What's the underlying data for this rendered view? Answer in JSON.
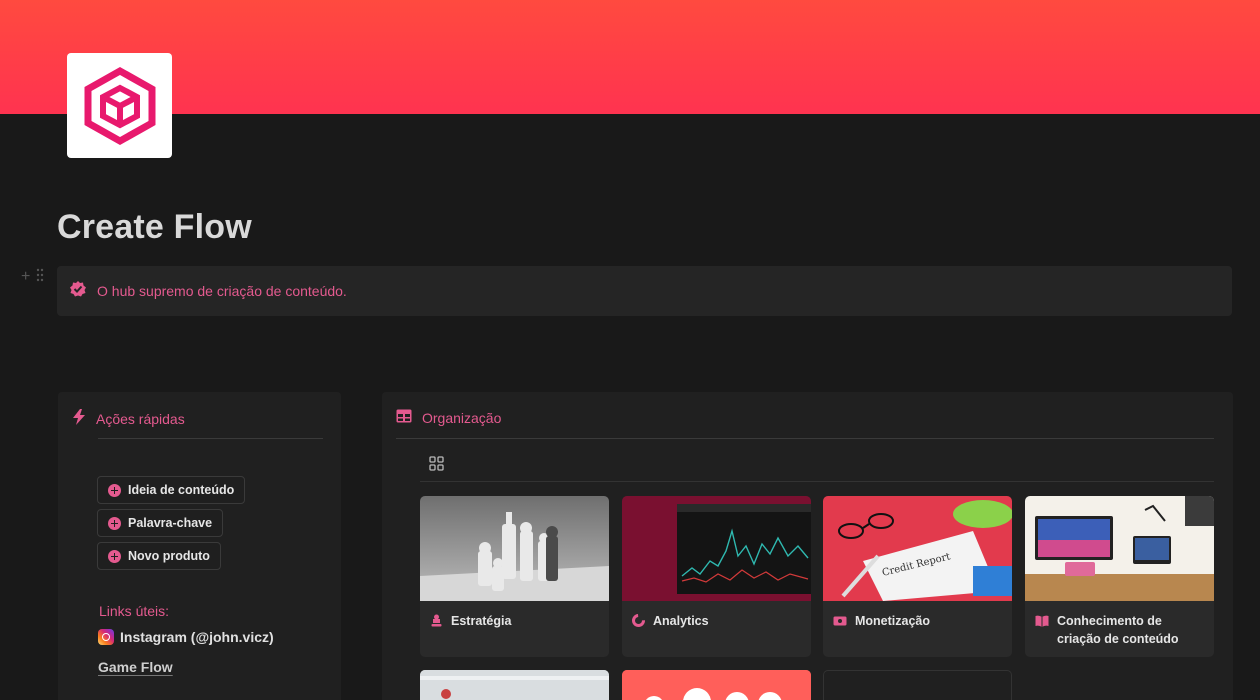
{
  "page": {
    "title": "Create Flow",
    "callout": "O hub supremo de criação de conteúdo."
  },
  "colors": {
    "accent": "#e45a8f",
    "cover": "#ff3d48",
    "background": "#191919",
    "panel": "#202020"
  },
  "quick_actions": {
    "title": "Ações rápidas",
    "buttons": [
      "Ideia de conteúdo",
      "Palavra-chave",
      "Novo produto"
    ],
    "links_title": "Links úteis:",
    "links": [
      "Instagram (@john.vicz)",
      "Game Flow"
    ]
  },
  "organization": {
    "title": "Organização",
    "cards": [
      {
        "label": "Estratégia",
        "icon": "chess-icon"
      },
      {
        "label": "Analytics",
        "icon": "pie-chart-icon"
      },
      {
        "label": "Monetização",
        "icon": "money-icon"
      },
      {
        "label": "Conhecimento de criação de conteúdo",
        "icon": "book-icon"
      }
    ]
  }
}
